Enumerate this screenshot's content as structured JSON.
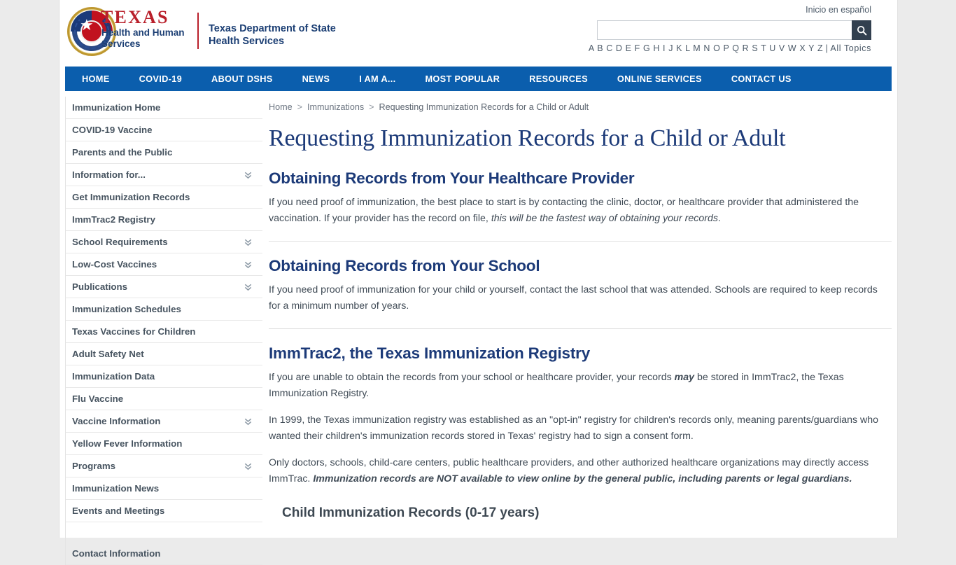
{
  "header": {
    "logo": {
      "texas": "TEXAS",
      "hhs": "Health and Human Services",
      "agency": "Texas Department of State Health Services"
    },
    "spanish_link": "Inicio en español",
    "search": {
      "value": "",
      "placeholder": ""
    },
    "alphabet": "A B C D E F G H I J K L M N O P Q R S T U V W X Y Z",
    "alphabet_separator": " | ",
    "all_topics": "All Topics"
  },
  "nav": {
    "items": [
      {
        "label": "HOME"
      },
      {
        "label": "COVID-19"
      },
      {
        "label": "ABOUT DSHS"
      },
      {
        "label": "NEWS"
      },
      {
        "label": "I AM A..."
      },
      {
        "label": "MOST POPULAR"
      },
      {
        "label": "RESOURCES"
      },
      {
        "label": "ONLINE SERVICES"
      },
      {
        "label": "CONTACT US"
      }
    ]
  },
  "sidebar": {
    "items": [
      {
        "label": "Immunization Home",
        "expandable": false
      },
      {
        "label": "COVID-19 Vaccine",
        "expandable": false
      },
      {
        "label": "Parents and the Public",
        "expandable": false
      },
      {
        "label": "Information for...",
        "expandable": true
      },
      {
        "label": "Get Immunization Records",
        "expandable": false
      },
      {
        "label": "ImmTrac2 Registry",
        "expandable": false
      },
      {
        "label": "School Requirements",
        "expandable": true
      },
      {
        "label": "Low-Cost Vaccines",
        "expandable": true
      },
      {
        "label": "Publications",
        "expandable": true
      },
      {
        "label": "Immunization Schedules",
        "expandable": false
      },
      {
        "label": "Texas Vaccines for Children",
        "expandable": false
      },
      {
        "label": "Adult Safety Net",
        "expandable": false
      },
      {
        "label": "Immunization Data",
        "expandable": false
      },
      {
        "label": "Flu Vaccine",
        "expandable": false
      },
      {
        "label": "Vaccine Information",
        "expandable": true
      },
      {
        "label": "Yellow Fever Information",
        "expandable": false
      },
      {
        "label": "Programs",
        "expandable": true
      },
      {
        "label": "Immunization News",
        "expandable": false
      },
      {
        "label": "Events and Meetings",
        "expandable": false
      },
      {
        "label": "Contact Information",
        "expandable": false,
        "gap": true
      }
    ]
  },
  "breadcrumb": {
    "home": "Home",
    "sep": ">",
    "section": "Immunizations",
    "current": "Requesting Immunization Records for a Child or Adult"
  },
  "main": {
    "title": "Requesting Immunization Records for a Child or Adult",
    "sections": [
      {
        "heading": "Obtaining Records from Your Healthcare Provider",
        "p1_a": "If you need proof of immunization, the best place to start is by contacting the clinic, doctor, or healthcare provider that administered the vaccination. If your provider has the record on file, ",
        "p1_em": "this will be the fastest way of obtaining your records",
        "p1_b": "."
      },
      {
        "heading": "Obtaining Records from Your School",
        "p1": "If you need proof of immunization for your child or yourself, contact the last school that was attended. Schools are required to keep records for a minimum number of years."
      },
      {
        "heading": "ImmTrac2, the Texas Immunization Registry",
        "p1_a": "If you are unable to obtain the records from your school or healthcare provider, your records ",
        "p1_bi": "may",
        "p1_b": " be stored in ImmTrac2, the Texas Immunization Registry.",
        "p2": "In 1999, the Texas immunization registry was established as an \"opt-in\" registry for children's records only, meaning parents/guardians who wanted their children's immunization records stored in Texas' registry had to sign a consent form.",
        "p3_a": "Only doctors, schools, child-care centers, public healthcare providers, and other authorized healthcare organizations may directly access ImmTrac. ",
        "p3_bi": "Immunization records are NOT available to view online by the general public, including parents or legal guardians.",
        "subheading": "Child Immunization Records (0-17 years)"
      }
    ]
  },
  "colors": {
    "nav_blue": "#0b5ead",
    "title_navy": "#1c3a78",
    "brand_red": "#b9202b",
    "search_btn": "#32404f",
    "subheading": "#3d4852"
  }
}
